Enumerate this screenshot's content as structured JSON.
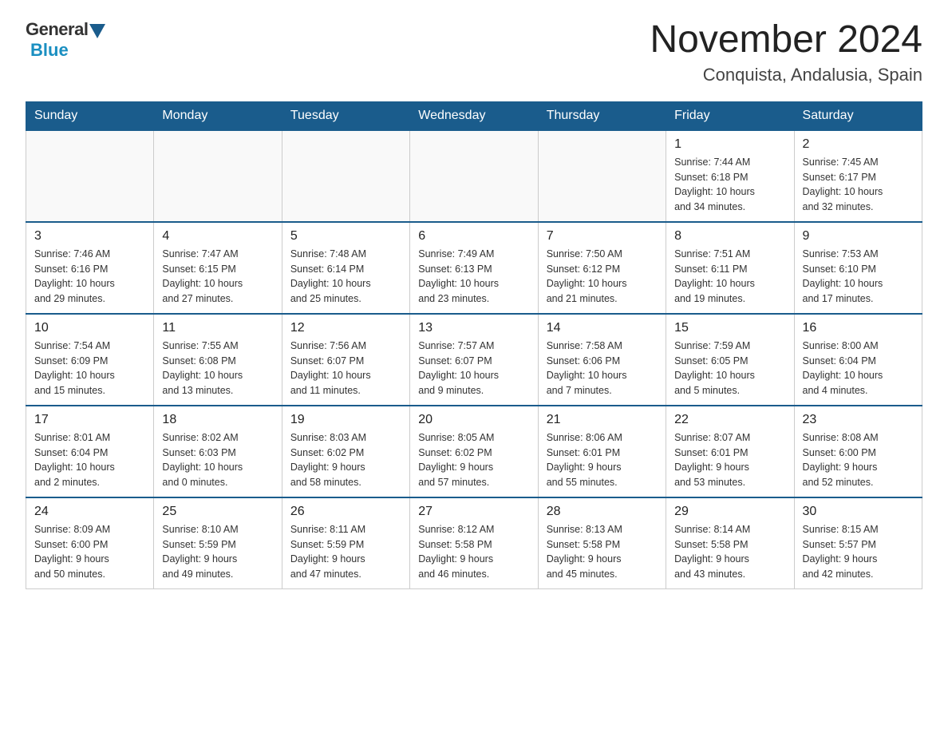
{
  "logo": {
    "general": "General",
    "blue": "Blue",
    "subtitle": ""
  },
  "header": {
    "month_title": "November 2024",
    "location": "Conquista, Andalusia, Spain"
  },
  "weekdays": [
    "Sunday",
    "Monday",
    "Tuesday",
    "Wednesday",
    "Thursday",
    "Friday",
    "Saturday"
  ],
  "weeks": [
    [
      {
        "day": "",
        "info": ""
      },
      {
        "day": "",
        "info": ""
      },
      {
        "day": "",
        "info": ""
      },
      {
        "day": "",
        "info": ""
      },
      {
        "day": "",
        "info": ""
      },
      {
        "day": "1",
        "info": "Sunrise: 7:44 AM\nSunset: 6:18 PM\nDaylight: 10 hours\nand 34 minutes."
      },
      {
        "day": "2",
        "info": "Sunrise: 7:45 AM\nSunset: 6:17 PM\nDaylight: 10 hours\nand 32 minutes."
      }
    ],
    [
      {
        "day": "3",
        "info": "Sunrise: 7:46 AM\nSunset: 6:16 PM\nDaylight: 10 hours\nand 29 minutes."
      },
      {
        "day": "4",
        "info": "Sunrise: 7:47 AM\nSunset: 6:15 PM\nDaylight: 10 hours\nand 27 minutes."
      },
      {
        "day": "5",
        "info": "Sunrise: 7:48 AM\nSunset: 6:14 PM\nDaylight: 10 hours\nand 25 minutes."
      },
      {
        "day": "6",
        "info": "Sunrise: 7:49 AM\nSunset: 6:13 PM\nDaylight: 10 hours\nand 23 minutes."
      },
      {
        "day": "7",
        "info": "Sunrise: 7:50 AM\nSunset: 6:12 PM\nDaylight: 10 hours\nand 21 minutes."
      },
      {
        "day": "8",
        "info": "Sunrise: 7:51 AM\nSunset: 6:11 PM\nDaylight: 10 hours\nand 19 minutes."
      },
      {
        "day": "9",
        "info": "Sunrise: 7:53 AM\nSunset: 6:10 PM\nDaylight: 10 hours\nand 17 minutes."
      }
    ],
    [
      {
        "day": "10",
        "info": "Sunrise: 7:54 AM\nSunset: 6:09 PM\nDaylight: 10 hours\nand 15 minutes."
      },
      {
        "day": "11",
        "info": "Sunrise: 7:55 AM\nSunset: 6:08 PM\nDaylight: 10 hours\nand 13 minutes."
      },
      {
        "day": "12",
        "info": "Sunrise: 7:56 AM\nSunset: 6:07 PM\nDaylight: 10 hours\nand 11 minutes."
      },
      {
        "day": "13",
        "info": "Sunrise: 7:57 AM\nSunset: 6:07 PM\nDaylight: 10 hours\nand 9 minutes."
      },
      {
        "day": "14",
        "info": "Sunrise: 7:58 AM\nSunset: 6:06 PM\nDaylight: 10 hours\nand 7 minutes."
      },
      {
        "day": "15",
        "info": "Sunrise: 7:59 AM\nSunset: 6:05 PM\nDaylight: 10 hours\nand 5 minutes."
      },
      {
        "day": "16",
        "info": "Sunrise: 8:00 AM\nSunset: 6:04 PM\nDaylight: 10 hours\nand 4 minutes."
      }
    ],
    [
      {
        "day": "17",
        "info": "Sunrise: 8:01 AM\nSunset: 6:04 PM\nDaylight: 10 hours\nand 2 minutes."
      },
      {
        "day": "18",
        "info": "Sunrise: 8:02 AM\nSunset: 6:03 PM\nDaylight: 10 hours\nand 0 minutes."
      },
      {
        "day": "19",
        "info": "Sunrise: 8:03 AM\nSunset: 6:02 PM\nDaylight: 9 hours\nand 58 minutes."
      },
      {
        "day": "20",
        "info": "Sunrise: 8:05 AM\nSunset: 6:02 PM\nDaylight: 9 hours\nand 57 minutes."
      },
      {
        "day": "21",
        "info": "Sunrise: 8:06 AM\nSunset: 6:01 PM\nDaylight: 9 hours\nand 55 minutes."
      },
      {
        "day": "22",
        "info": "Sunrise: 8:07 AM\nSunset: 6:01 PM\nDaylight: 9 hours\nand 53 minutes."
      },
      {
        "day": "23",
        "info": "Sunrise: 8:08 AM\nSunset: 6:00 PM\nDaylight: 9 hours\nand 52 minutes."
      }
    ],
    [
      {
        "day": "24",
        "info": "Sunrise: 8:09 AM\nSunset: 6:00 PM\nDaylight: 9 hours\nand 50 minutes."
      },
      {
        "day": "25",
        "info": "Sunrise: 8:10 AM\nSunset: 5:59 PM\nDaylight: 9 hours\nand 49 minutes."
      },
      {
        "day": "26",
        "info": "Sunrise: 8:11 AM\nSunset: 5:59 PM\nDaylight: 9 hours\nand 47 minutes."
      },
      {
        "day": "27",
        "info": "Sunrise: 8:12 AM\nSunset: 5:58 PM\nDaylight: 9 hours\nand 46 minutes."
      },
      {
        "day": "28",
        "info": "Sunrise: 8:13 AM\nSunset: 5:58 PM\nDaylight: 9 hours\nand 45 minutes."
      },
      {
        "day": "29",
        "info": "Sunrise: 8:14 AM\nSunset: 5:58 PM\nDaylight: 9 hours\nand 43 minutes."
      },
      {
        "day": "30",
        "info": "Sunrise: 8:15 AM\nSunset: 5:57 PM\nDaylight: 9 hours\nand 42 minutes."
      }
    ]
  ]
}
